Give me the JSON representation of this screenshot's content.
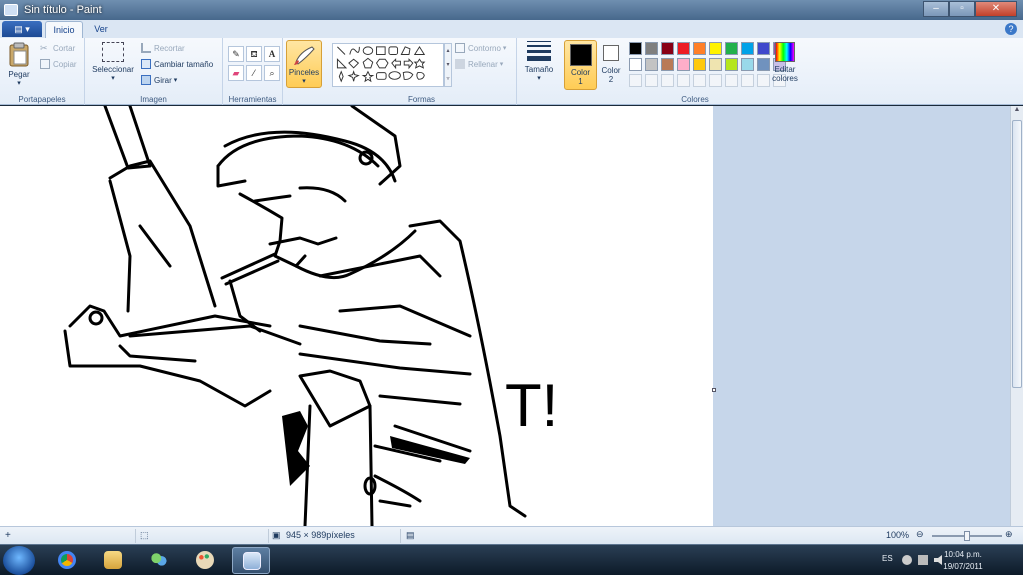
{
  "window": {
    "title": "Sin título - Paint"
  },
  "tabs": {
    "inicio": "Inicio",
    "ver": "Ver"
  },
  "ribbon": {
    "portapapeles": {
      "label": "Portapapeles",
      "pegar": "Pegar",
      "cortar": "Cortar",
      "copiar": "Copiar"
    },
    "imagen": {
      "label": "Imagen",
      "seleccionar": "Seleccionar",
      "recortar": "Recortar",
      "cambiar_tamano": "Cambiar tamaño",
      "girar": "Girar"
    },
    "herramientas": {
      "label": "Herramientas",
      "text_tool": "A"
    },
    "pinceles": {
      "label": "Pinceles"
    },
    "formas": {
      "label": "Formas",
      "contorno": "Contorno",
      "rellenar": "Rellenar"
    },
    "tamano": {
      "label": "Tamaño"
    },
    "color1": {
      "label": "Color",
      "num": "1",
      "value": "#000000"
    },
    "color2": {
      "label": "Color",
      "num": "2",
      "value": "#ffffff"
    },
    "colores": {
      "label": "Colores",
      "palette_row1": [
        "#000000",
        "#7f7f7f",
        "#880015",
        "#ed1c24",
        "#ff7f27",
        "#fff200",
        "#22b14c",
        "#00a2e8",
        "#3f48cc",
        "#a349a4"
      ],
      "palette_row2": [
        "#ffffff",
        "#c3c3c3",
        "#b97a57",
        "#ffaec9",
        "#ffc90e",
        "#efe4b0",
        "#b5e61d",
        "#99d9ea",
        "#7092be",
        "#c8bfe7"
      ],
      "editar_line1": "Editar",
      "editar_line2": "colores"
    }
  },
  "canvas": {
    "text": "T!"
  },
  "status": {
    "size": "945 × 989píxeles",
    "zoom": "100%"
  },
  "taskbar": {
    "lang": "ES",
    "time": "10:04 p.m.",
    "date": "19/07/2011"
  }
}
